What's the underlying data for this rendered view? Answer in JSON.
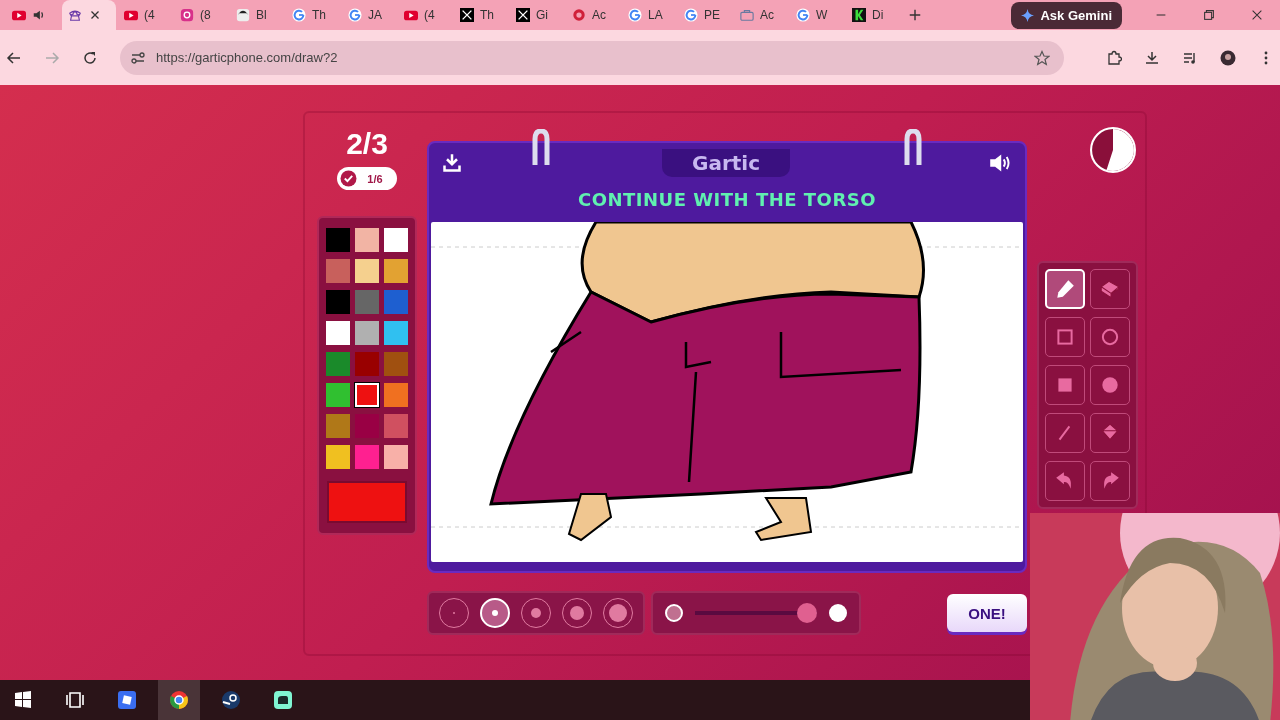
{
  "browser": {
    "tabs": [
      {
        "kind": "youtube",
        "audio": true,
        "selected": false
      },
      {
        "kind": "phone",
        "audio": false,
        "selected": true
      },
      {
        "kind": "youtube",
        "label": "(4",
        "audio": false,
        "selected": false
      },
      {
        "kind": "instagram",
        "label": "(8",
        "audio": false,
        "selected": false
      },
      {
        "kind": "avatar",
        "label": "Bl",
        "audio": false,
        "selected": false
      },
      {
        "kind": "google",
        "label": "Th",
        "audio": false,
        "selected": false
      },
      {
        "kind": "google",
        "label": "JA",
        "audio": false,
        "selected": false
      },
      {
        "kind": "youtube",
        "label": "(4",
        "audio": false,
        "selected": false
      },
      {
        "kind": "x",
        "label": "Th",
        "audio": false,
        "selected": false
      },
      {
        "kind": "x",
        "label": "Gi",
        "audio": false,
        "selected": false
      },
      {
        "kind": "swirl",
        "label": "Ac",
        "audio": false,
        "selected": false
      },
      {
        "kind": "google",
        "label": "LA",
        "audio": false,
        "selected": false
      },
      {
        "kind": "google",
        "label": "PE",
        "audio": false,
        "selected": false
      },
      {
        "kind": "bag",
        "label": "Ac",
        "audio": false,
        "selected": false
      },
      {
        "kind": "google",
        "label": "W",
        "audio": false,
        "selected": false
      },
      {
        "kind": "k",
        "label": "Di",
        "audio": false,
        "selected": false
      }
    ],
    "gemini": "Ask Gemini",
    "address": "https://garticphone.com/draw?2"
  },
  "game": {
    "round": "2/3",
    "done_count": "1/6",
    "logo": "Gartic",
    "prompt": "CONTINUE WITH THE TORSO",
    "timer": {
      "level": 0.55
    },
    "palette": [
      {
        "color": "#000000",
        "selected": false
      },
      {
        "color": "#f2b4a4",
        "selected": false
      },
      {
        "color": "#ffffff",
        "selected": false
      },
      {
        "color": "#c8605c",
        "selected": false
      },
      {
        "color": "#f5d08e",
        "selected": false
      },
      {
        "color": "#e2a232",
        "selected": false
      },
      {
        "color": "#000000",
        "selected": false
      },
      {
        "color": "#666666",
        "selected": false
      },
      {
        "color": "#1e5fd0",
        "selected": false
      },
      {
        "color": "#ffffff",
        "selected": false
      },
      {
        "color": "#b0b0b0",
        "selected": false
      },
      {
        "color": "#30c0f0",
        "selected": false
      },
      {
        "color": "#1a8a2a",
        "selected": false
      },
      {
        "color": "#990000",
        "selected": false
      },
      {
        "color": "#a05010",
        "selected": false
      },
      {
        "color": "#30c030",
        "selected": false
      },
      {
        "color": "#ee1111",
        "selected": true
      },
      {
        "color": "#f07020",
        "selected": false
      },
      {
        "color": "#b07818",
        "selected": false
      },
      {
        "color": "#990044",
        "selected": false
      },
      {
        "color": "#d05060",
        "selected": false
      },
      {
        "color": "#f0c020",
        "selected": false
      },
      {
        "color": "#ff2090",
        "selected": false
      },
      {
        "color": "#f8b0a8",
        "selected": false
      }
    ],
    "tools": [
      {
        "kind": "pencil",
        "selected": true
      },
      {
        "kind": "eraser",
        "selected": false
      },
      {
        "kind": "rect",
        "selected": false
      },
      {
        "kind": "ellipse",
        "selected": false
      },
      {
        "kind": "rect-fill",
        "selected": false
      },
      {
        "kind": "ellipse-fill",
        "selected": false
      },
      {
        "kind": "line",
        "selected": false
      },
      {
        "kind": "bucket",
        "selected": false
      },
      {
        "kind": "undo",
        "selected": false
      },
      {
        "kind": "redo",
        "selected": false
      }
    ],
    "brush_sizes": [
      {
        "selected": false
      },
      {
        "selected": true
      },
      {
        "selected": false
      },
      {
        "selected": false
      },
      {
        "selected": false
      }
    ],
    "opacity": {
      "level": 1
    },
    "done_button": "ONE!"
  },
  "taskbar": [
    {
      "kind": "windows",
      "selected": false
    },
    {
      "kind": "taskview",
      "selected": false
    },
    {
      "kind": "roblox",
      "selected": false
    },
    {
      "kind": "chrome",
      "selected": true
    },
    {
      "kind": "steam",
      "selected": false
    },
    {
      "kind": "streamlabs",
      "selected": false
    }
  ]
}
